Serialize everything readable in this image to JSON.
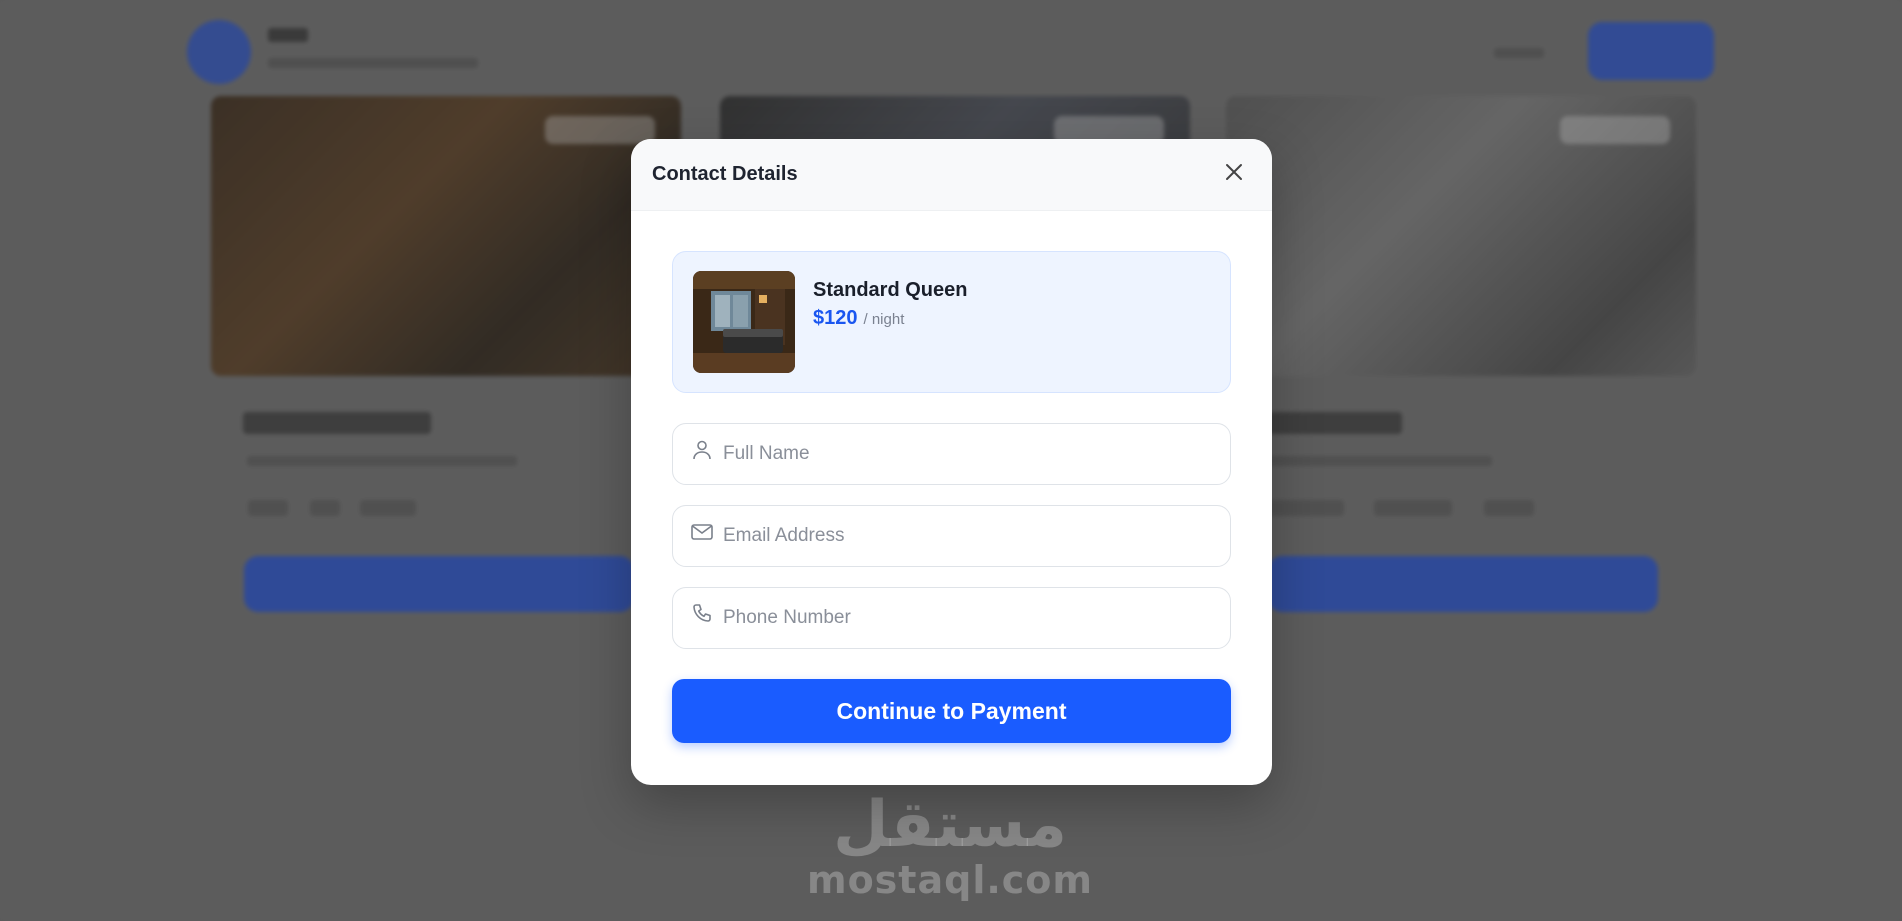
{
  "modal": {
    "title": "Contact Details",
    "close_icon": "close-icon"
  },
  "room": {
    "name": "Standard Queen",
    "price": "$120",
    "unit": "/ night"
  },
  "form": {
    "full_name_placeholder": "Full Name",
    "email_placeholder": "Email Address",
    "phone_placeholder": "Phone Number",
    "full_name_value": "",
    "email_value": "",
    "phone_value": "",
    "submit_label": "Continue to Payment"
  },
  "icons": {
    "name": "user-icon",
    "email": "mail-icon",
    "phone": "phone-icon"
  },
  "colors": {
    "accent": "#1a5cff",
    "price": "#1a56f0",
    "room_card_bg": "#eef4ff"
  },
  "watermark": {
    "arabic": "مستقل",
    "latin": "mostaql.com"
  }
}
